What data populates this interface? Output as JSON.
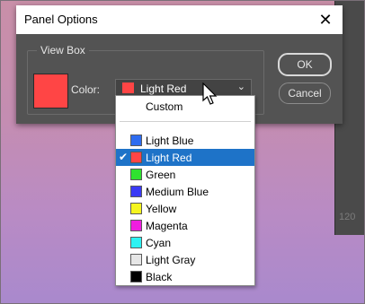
{
  "dialog": {
    "title": "Panel Options",
    "close_glyph": "✕",
    "group_label": "View Box",
    "color_label": "Color:",
    "selected_color": "Light Red",
    "selected_swatch": "#ff4545",
    "ok_label": "OK",
    "cancel_label": "Cancel"
  },
  "dropdown": {
    "custom_label": "Custom",
    "items": [
      {
        "label": "Light Blue",
        "color": "#2e6cf0"
      },
      {
        "label": "Light Red",
        "color": "#ff4545",
        "selected": true
      },
      {
        "label": "Green",
        "color": "#2fe22f"
      },
      {
        "label": "Medium Blue",
        "color": "#3a3af5"
      },
      {
        "label": "Yellow",
        "color": "#f5f51e"
      },
      {
        "label": "Magenta",
        "color": "#f01ee0"
      },
      {
        "label": "Cyan",
        "color": "#2ef2f2"
      },
      {
        "label": "Light Gray",
        "color": "#e6e6e6"
      },
      {
        "label": "Black",
        "color": "#000000"
      }
    ]
  },
  "background": {
    "number": "120"
  }
}
